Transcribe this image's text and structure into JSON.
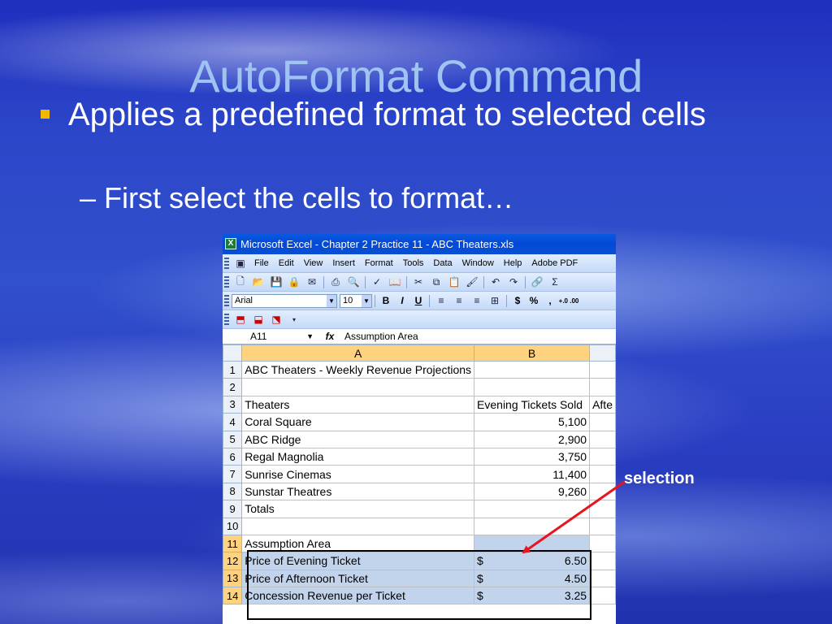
{
  "slide": {
    "title": "AutoFormat Command",
    "bullet": "Applies a predefined format to selected cells",
    "sub_bullet": "– First select the cells to format…",
    "callout": "selection",
    "colors": {
      "title": "#9fc4f2",
      "bullet_marker": "#f2b800",
      "arrow": "#e8141e"
    }
  },
  "excel": {
    "window_title": "Microsoft Excel - Chapter 2 Practice 11 - ABC Theaters.xls",
    "menu": [
      "File",
      "Edit",
      "View",
      "Insert",
      "Format",
      "Tools",
      "Data",
      "Window",
      "Help",
      "Adobe PDF"
    ],
    "toolbar_icons": [
      "new-icon",
      "open-icon",
      "save-icon",
      "permission-icon",
      "print-icon",
      "print-preview-icon",
      "spelling-icon",
      "research-icon",
      "cut-icon",
      "copy-icon",
      "paste-icon",
      "format-painter-icon",
      "undo-icon",
      "redo-icon",
      "hyperlink-icon",
      "autosum-icon"
    ],
    "font_name": "Arial",
    "font_size": "10",
    "format_buttons": [
      "B",
      "I",
      "U"
    ],
    "number_buttons": [
      "$",
      "%",
      ",",
      "+.0 .00"
    ],
    "name_box": "A11",
    "fx_label": "fx",
    "formula": "Assumption Area",
    "columns": [
      "A",
      "B"
    ],
    "rows": [
      {
        "num": "1",
        "a": "ABC Theaters - Weekly Revenue Projections",
        "b": "",
        "c": ""
      },
      {
        "num": "2",
        "a": "",
        "b": "",
        "c": ""
      },
      {
        "num": "3",
        "a": "Theaters",
        "b": "Evening Tickets Sold",
        "c": "Afte"
      },
      {
        "num": "4",
        "a": "Coral Square",
        "b": "5,100",
        "c": ""
      },
      {
        "num": "5",
        "a": "ABC Ridge",
        "b": "2,900",
        "c": ""
      },
      {
        "num": "6",
        "a": "Regal Magnolia",
        "b": "3,750",
        "c": ""
      },
      {
        "num": "7",
        "a": "Sunrise Cinemas",
        "b": "11,400",
        "c": ""
      },
      {
        "num": "8",
        "a": "Sunstar Theatres",
        "b": "9,260",
        "c": ""
      },
      {
        "num": "9",
        "a": "Totals",
        "b": "",
        "c": ""
      },
      {
        "num": "10",
        "a": "",
        "b": "",
        "c": ""
      },
      {
        "num": "11",
        "a": "Assumption Area",
        "b": "",
        "c": ""
      },
      {
        "num": "12",
        "a": "Price of Evening Ticket",
        "b": "6.50",
        "c": "",
        "currency": "$"
      },
      {
        "num": "13",
        "a": "Price of Afternoon Ticket",
        "b": "4.50",
        "c": "",
        "currency": "$"
      },
      {
        "num": "14",
        "a": "Concession Revenue per Ticket",
        "b": "3.25",
        "c": "",
        "currency": "$"
      }
    ]
  }
}
